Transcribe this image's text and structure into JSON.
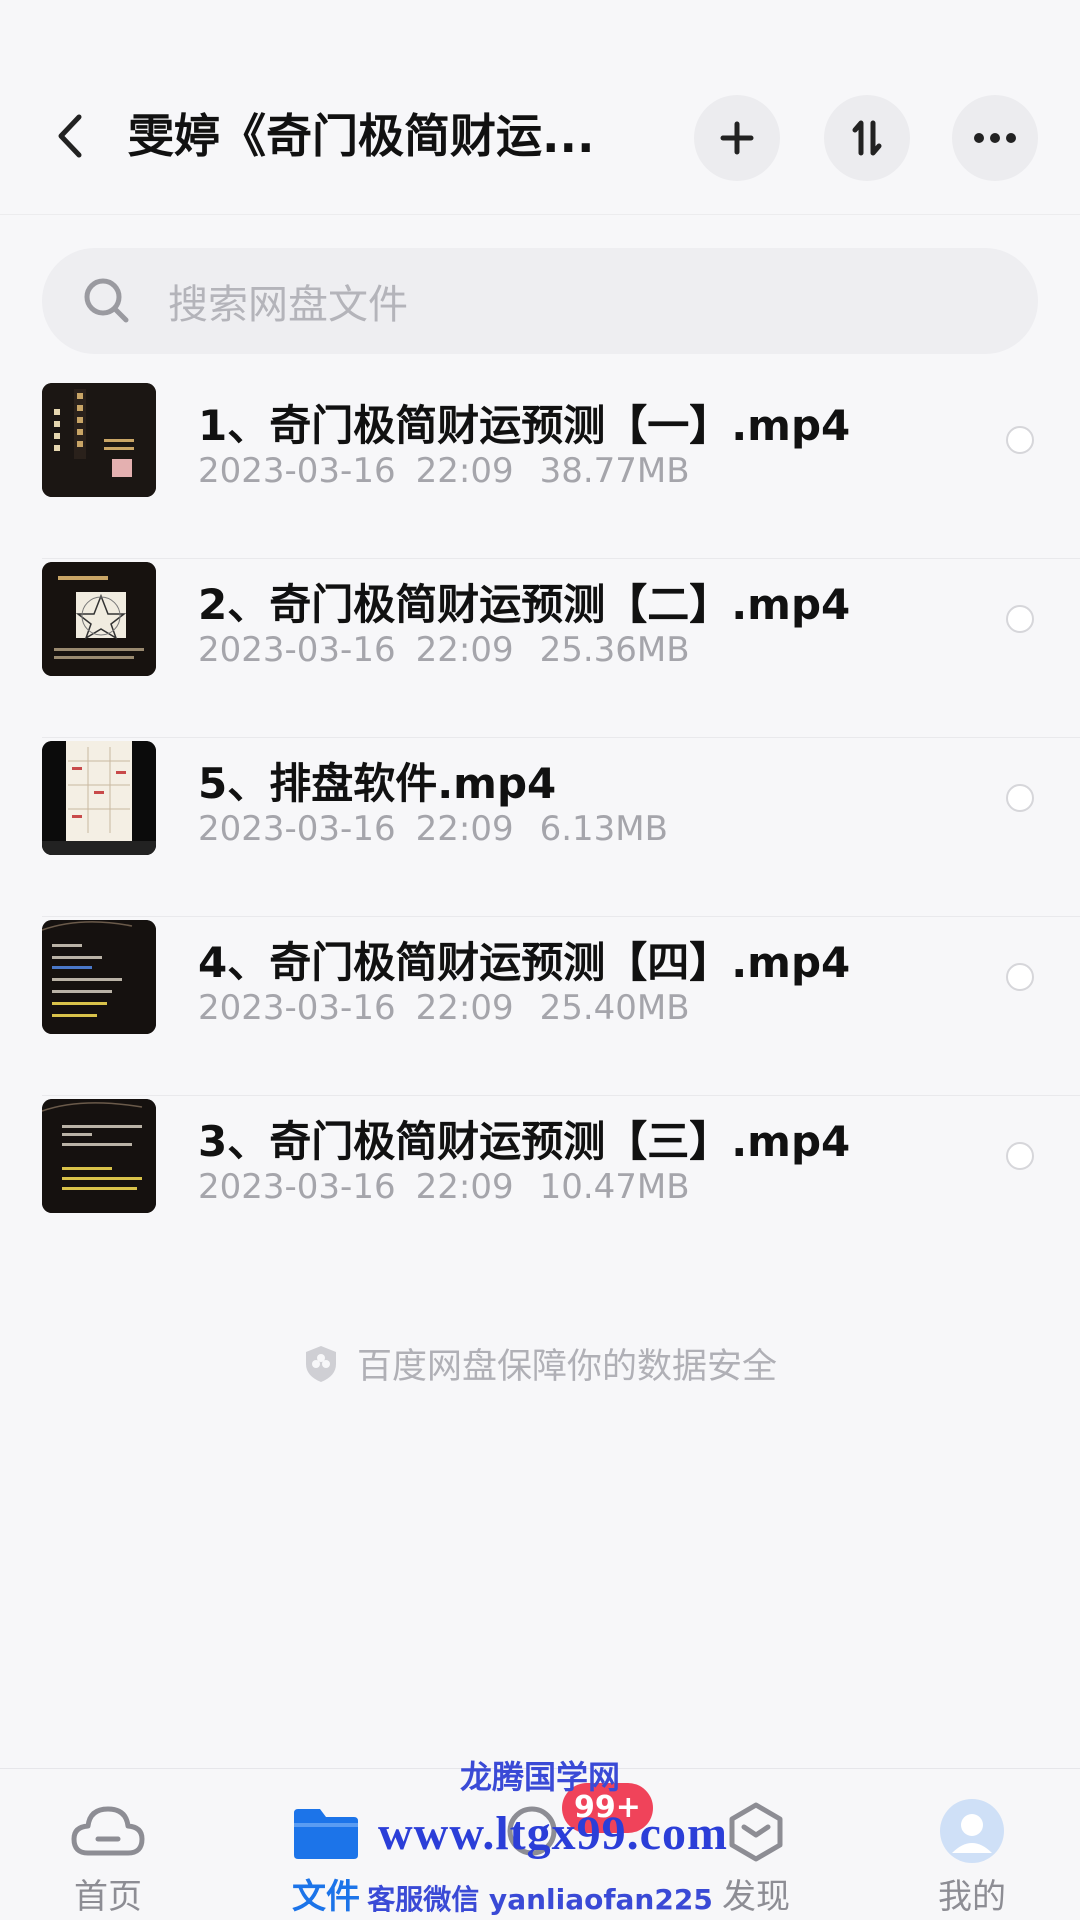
{
  "header": {
    "title": "雯婷《奇门极简财运...",
    "add_icon": "plus-icon",
    "sort_icon": "sort-icon",
    "more_icon": "more-dots-icon"
  },
  "search": {
    "placeholder": "搜索网盘文件"
  },
  "files": [
    {
      "name": "1、奇门极简财运预测【一】.mp4",
      "date": "2023-03-16",
      "time": "22:09",
      "size": "38.77MB",
      "thumb": "dark-cover"
    },
    {
      "name": "2、奇门极简财运预测【二】.mp4",
      "date": "2023-03-16",
      "time": "22:09",
      "size": "25.36MB",
      "thumb": "pentagram-slide"
    },
    {
      "name": "5、排盘软件.mp4",
      "date": "2023-03-16",
      "time": "22:09",
      "size": "6.13MB",
      "thumb": "software-screen"
    },
    {
      "name": "4、奇门极简财运预测【四】.mp4",
      "date": "2023-03-16",
      "time": "22:09",
      "size": "25.40MB",
      "thumb": "dark-text-slide"
    },
    {
      "name": "3、奇门极简财运预测【三】.mp4",
      "date": "2023-03-16",
      "time": "22:09",
      "size": "10.47MB",
      "thumb": "dark-text-slide"
    }
  ],
  "security_note": "百度网盘保障你的数据安全",
  "bottom_nav": {
    "home": "首页",
    "files": "文件",
    "share_badge": "99+",
    "discover": "发现",
    "mine": "我的"
  },
  "watermark": {
    "line1": "龙腾国学网",
    "line2": "www.ltgx99.com",
    "line3": "客服微信 yanliaofan225"
  },
  "colors": {
    "accent": "#1c74e9",
    "badge": "#f0435a",
    "background": "#f7f7f9"
  }
}
